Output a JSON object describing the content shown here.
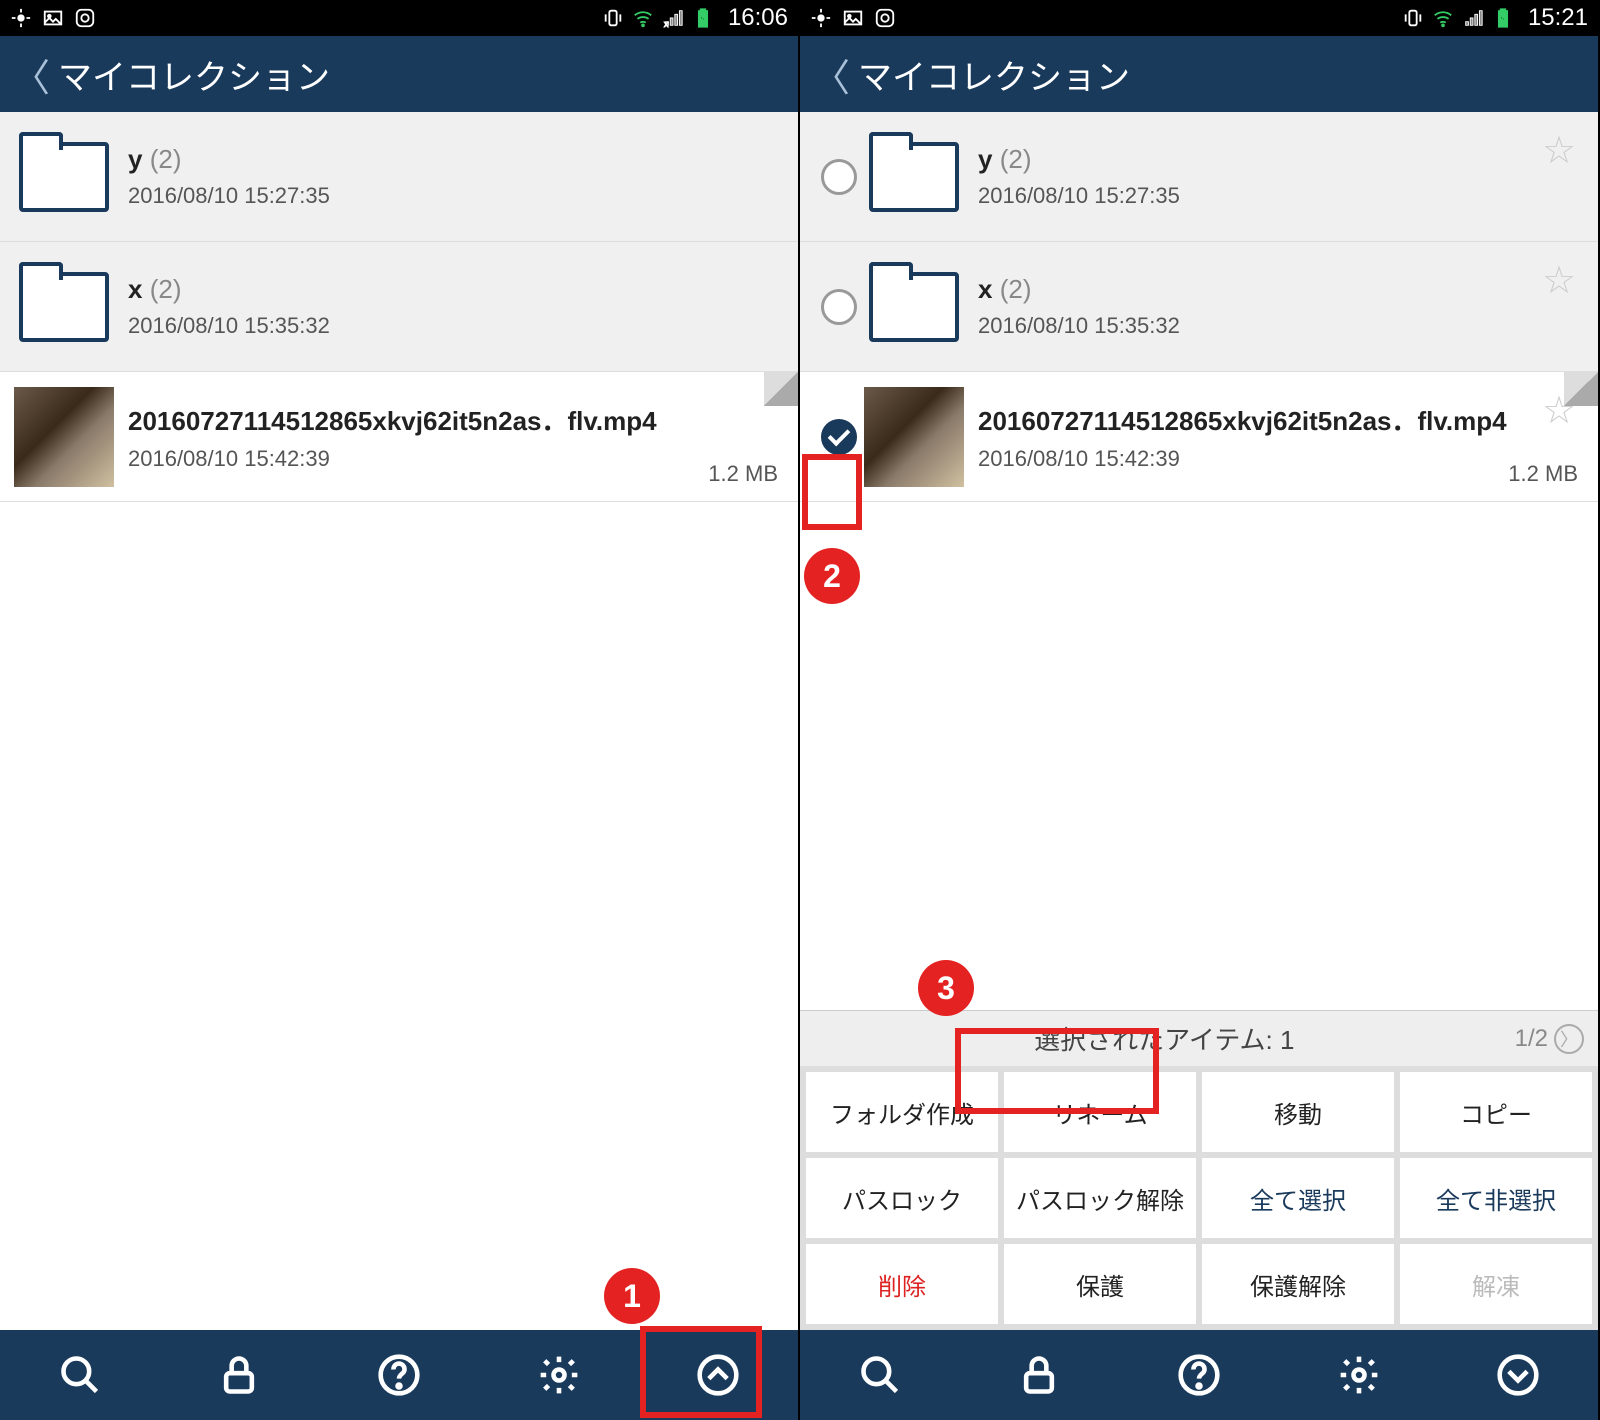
{
  "left": {
    "status": {
      "time": "16:06"
    },
    "header": {
      "title": "マイコレクション"
    },
    "items": [
      {
        "name": "y",
        "count": "(2)",
        "date": "2016/08/10 15:27:35",
        "type": "folder"
      },
      {
        "name": "x",
        "count": "(2)",
        "date": "2016/08/10 15:35:32",
        "type": "folder"
      },
      {
        "name": "20160727114512865xkvj62it5n2as．flv.mp4",
        "date": "2016/08/10 15:42:39",
        "size": "1.2 MB",
        "type": "file"
      }
    ],
    "callouts": {
      "one": "1"
    }
  },
  "right": {
    "status": {
      "time": "15:21"
    },
    "header": {
      "title": "マイコレクション"
    },
    "items": [
      {
        "name": "y",
        "count": "(2)",
        "date": "2016/08/10 15:27:35",
        "type": "folder",
        "checked": false
      },
      {
        "name": "x",
        "count": "(2)",
        "date": "2016/08/10 15:35:32",
        "type": "folder",
        "checked": false
      },
      {
        "name": "20160727114512865xkvj62it5n2as．flv.mp4",
        "date": "2016/08/10 15:42:39",
        "size": "1.2 MB",
        "type": "file",
        "checked": true
      }
    ],
    "action_header": {
      "text": "選択されたアイテム: 1",
      "page": "1/2"
    },
    "actions": {
      "create_folder": "フォルダ作成",
      "rename": "リネーム",
      "move": "移動",
      "copy": "コピー",
      "passlock": "パスロック",
      "passlock_remove": "パスロック解除",
      "select_all": "全て選択",
      "deselect_all": "全て非選択",
      "delete": "削除",
      "protect": "保護",
      "unprotect": "保護解除",
      "extract": "解凍"
    },
    "callouts": {
      "two": "2",
      "three": "3"
    }
  }
}
